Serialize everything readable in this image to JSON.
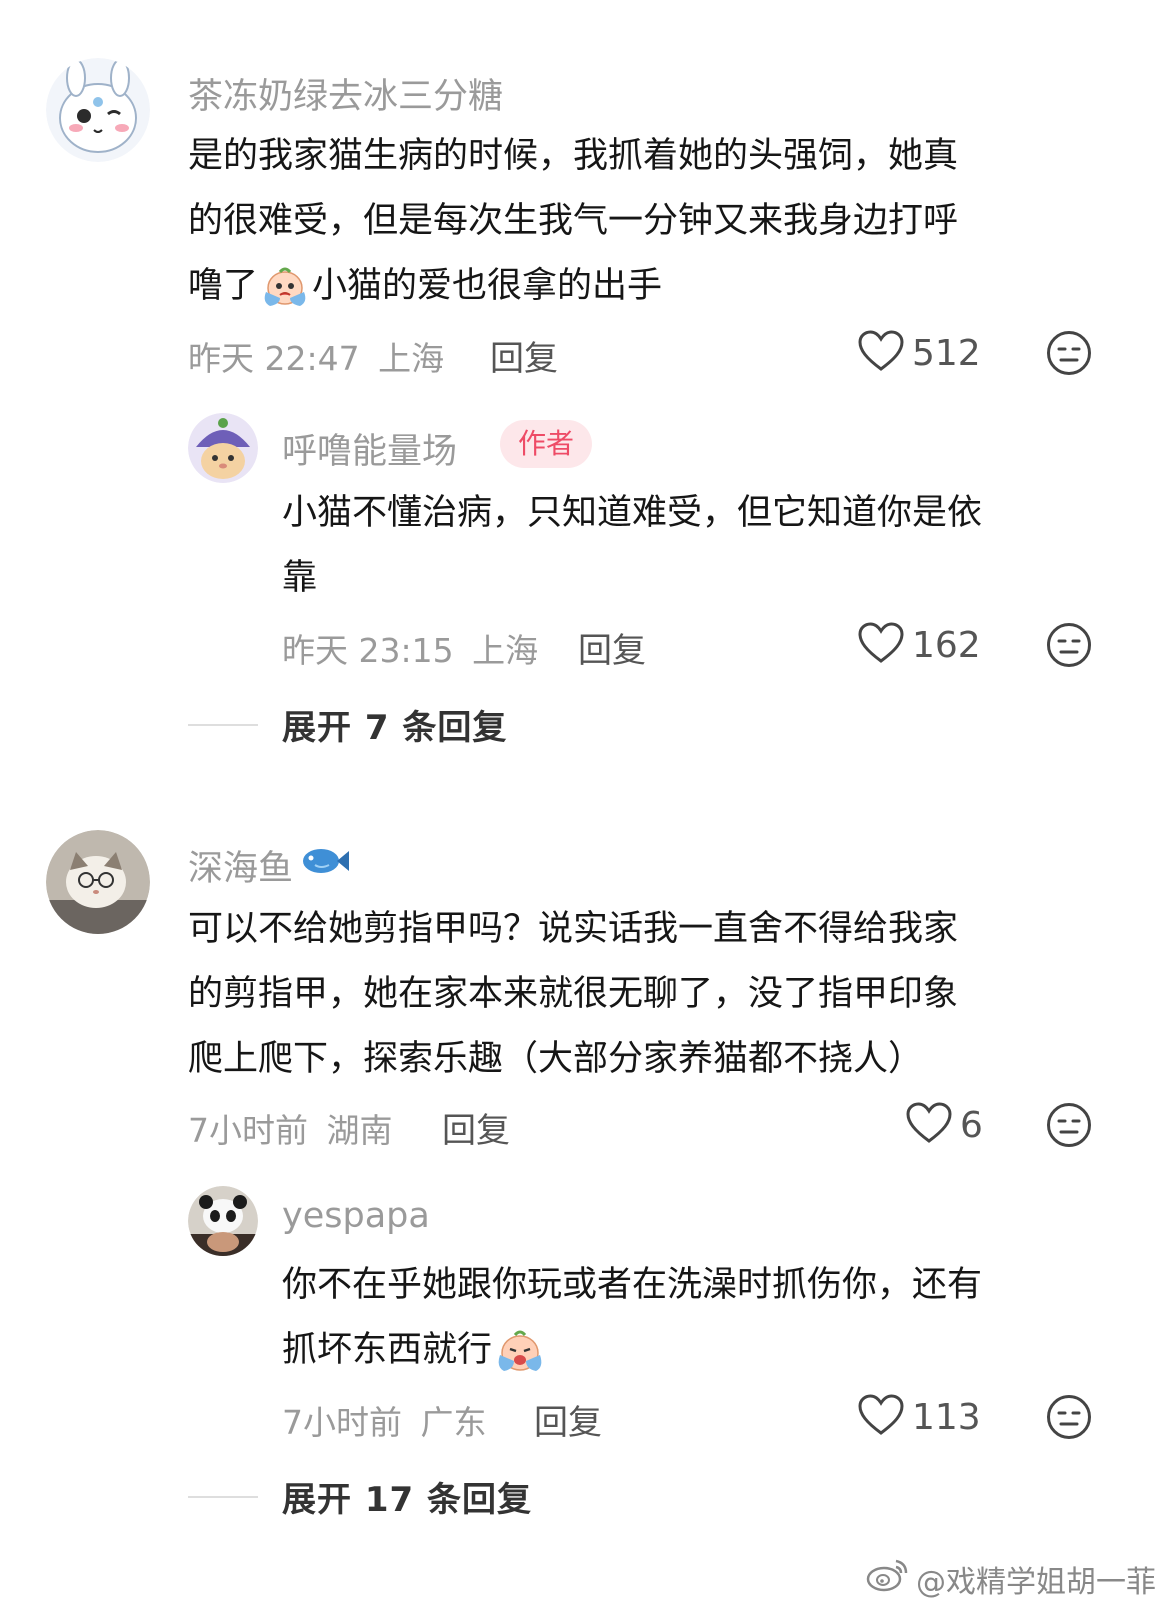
{
  "comments": [
    {
      "username": "茶冻奶绿去冰三分糖",
      "lines": [
        "是的我家猫生病的时候，我抓着她的头强饲，她真",
        "的很难受，但是每次生我气一分钟又来我身边打呼",
        "噜了",
        "小猫的爱也很拿的出手"
      ],
      "time": "昨天 22:47",
      "location": "上海",
      "reply_label": "回复",
      "likes": "512",
      "reply": {
        "username": "呼噜能量场",
        "badge": "作者",
        "lines": [
          "小猫不懂治病，只知道难受，但它知道你是依",
          "靠"
        ],
        "time": "昨天 23:15",
        "location": "上海",
        "reply_label": "回复",
        "likes": "162"
      },
      "expand_label": "展开 7 条回复"
    },
    {
      "username": "深海鱼",
      "lines": [
        "可以不给她剪指甲吗？说实话我一直舍不得给我家",
        "的剪指甲，她在家本来就很无聊了，没了指甲印象",
        "爬上爬下，探索乐趣（大部分家养猫都不挠人）"
      ],
      "time": "7小时前",
      "location": "湖南",
      "reply_label": "回复",
      "likes": "6",
      "reply": {
        "username": "yespapa",
        "lines": [
          "你不在乎她跟你玩或者在洗澡时抓伤你，还有",
          "抓坏东西就行"
        ],
        "time": "7小时前",
        "location": "广东",
        "reply_label": "回复",
        "likes": "113"
      },
      "expand_label": "展开 17 条回复"
    }
  ],
  "watermark": "@戏精学姐胡一菲",
  "colors": {
    "author_badge_bg": "#fde7ea",
    "author_badge_text": "#ee4b66",
    "meta": "#9a9a9a"
  }
}
